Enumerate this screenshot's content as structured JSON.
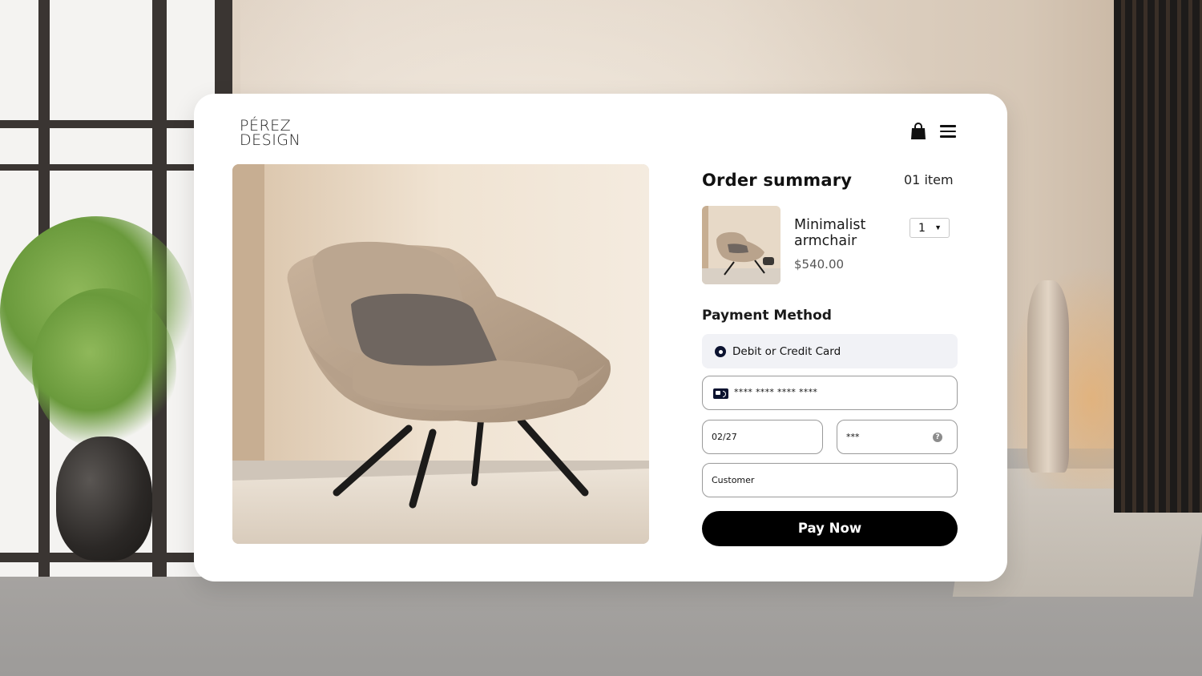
{
  "brand": {
    "line1": "PÉREZ",
    "line2": "DESIGN"
  },
  "header": {
    "cart_icon": "shopping-bag-icon",
    "menu_icon": "hamburger-menu-icon"
  },
  "order_summary": {
    "title": "Order summary",
    "item_count": "01 item",
    "item": {
      "name": "Minimalist armchair",
      "price": "$540.00",
      "quantity": "1"
    }
  },
  "payment": {
    "title": "Payment Method",
    "method_label": "Debit or Credit Card",
    "card_number": "**** **** **** ****",
    "expiry": "02/27",
    "cvv": "***",
    "cvv_help": "?",
    "cardholder": "Customer",
    "pay_label": "Pay Now"
  },
  "colors": {
    "accent": "#000000",
    "radio": "#0c1330",
    "option_bg": "#f1f2f6"
  }
}
